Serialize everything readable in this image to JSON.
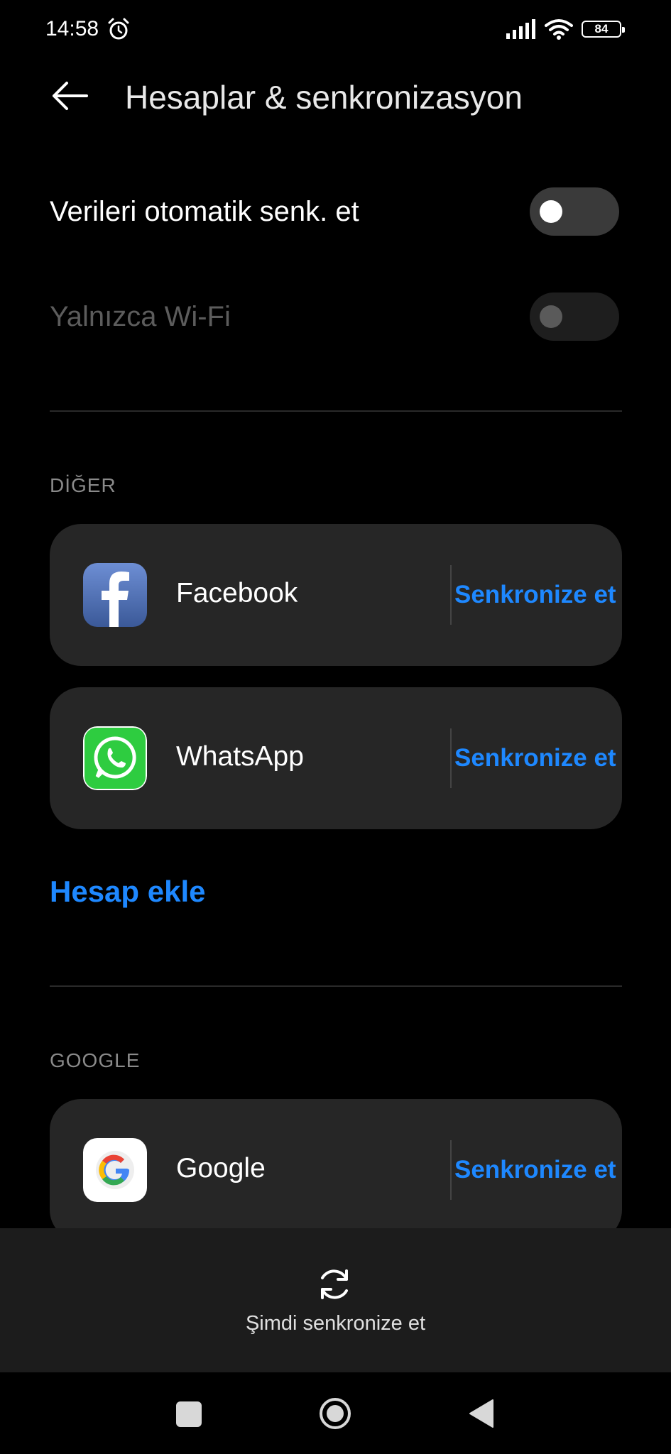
{
  "status_bar": {
    "time": "14:58",
    "battery": "84"
  },
  "header": {
    "title": "Hesaplar & senkronizasyon"
  },
  "settings": {
    "auto_sync_label": "Verileri otomatik senk. et",
    "auto_sync_on": false,
    "wifi_only_label": "Yalnızca Wi-Fi",
    "wifi_only_on": false,
    "wifi_only_enabled": false
  },
  "other_section": {
    "header": "DİĞER",
    "accounts": [
      {
        "name": "Facebook",
        "action": "Senkronize et",
        "icon": "facebook-icon"
      },
      {
        "name": "WhatsApp",
        "action": "Senkronize et",
        "icon": "whatsapp-icon"
      }
    ],
    "add_account": "Hesap ekle"
  },
  "google_section": {
    "header": "GOOGLE",
    "accounts": [
      {
        "name": "Google",
        "action": "Senkronize et",
        "icon": "google-icon"
      }
    ]
  },
  "bottom": {
    "sync_now": "Şimdi senkronize et"
  },
  "colors": {
    "accent": "#1e88ff",
    "background": "#000000",
    "card": "#262626"
  }
}
